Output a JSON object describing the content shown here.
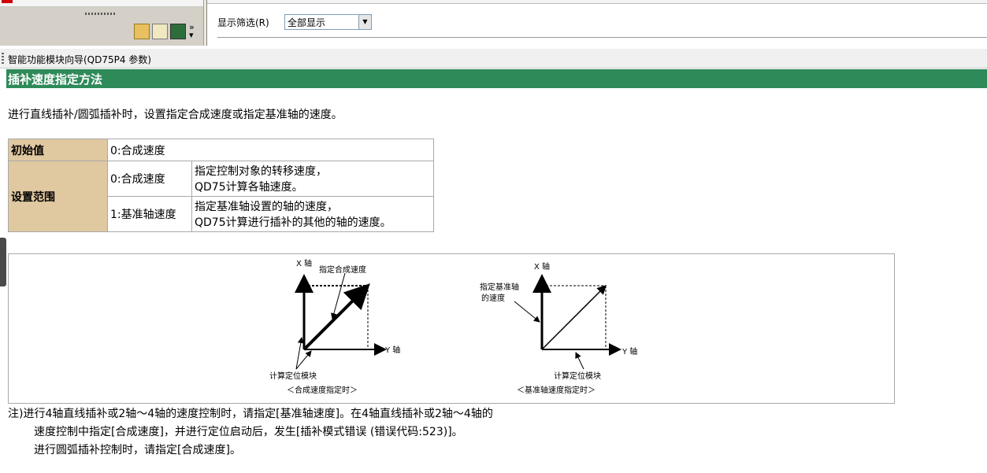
{
  "toolbar": {
    "filter_label": "显示筛选(R)",
    "filter_value": "全部显示",
    "icons": [
      "parameter-icon",
      "edit-icon",
      "monitor-icon",
      "chevron-more-icon"
    ]
  },
  "wizard": {
    "title": "智能功能模块向导(QD75P4 参数)"
  },
  "section": {
    "title": "插补速度指定方法",
    "intro": "进行直线插补/圆弧插补时，设置指定合成速度或指定基准轴的速度。"
  },
  "spec_table": {
    "initial_label": "初始值",
    "initial_value": "0:合成速度",
    "range_label": "设置范围",
    "rows": [
      {
        "option": "0:合成速度",
        "desc1": "指定控制对象的转移速度，",
        "desc2": "QD75计算各轴速度。"
      },
      {
        "option": "1:基准轴速度",
        "desc1": "指定基准轴设置的轴的速度，",
        "desc2": "QD75计算进行插补的其他的轴的速度。"
      }
    ]
  },
  "diagram": {
    "left": {
      "x_axis": "X 轴",
      "y_axis": "Y 轴",
      "annot_top": "指定合成速度",
      "annot_bottom": "计算定位模块",
      "caption": "＜合成速度指定时＞"
    },
    "right": {
      "x_axis": "X 轴",
      "y_axis": "Y 轴",
      "annot_top1": "指定基准轴",
      "annot_top2": "的速度",
      "annot_bottom": "计算定位模块",
      "caption": "＜基准轴速度指定时＞"
    }
  },
  "notes": {
    "line1": "注)进行4轴直线插补或2轴～4轴的速度控制时，请指定[基准轴速度]。在4轴直线插补或2轴～4轴的",
    "line2": "速度控制中指定[合成速度]，并进行定位启动后，发生[插补模式错误 (错误代码:523)]。",
    "line3": "进行圆弧插补控制时，请指定[合成速度]。"
  }
}
